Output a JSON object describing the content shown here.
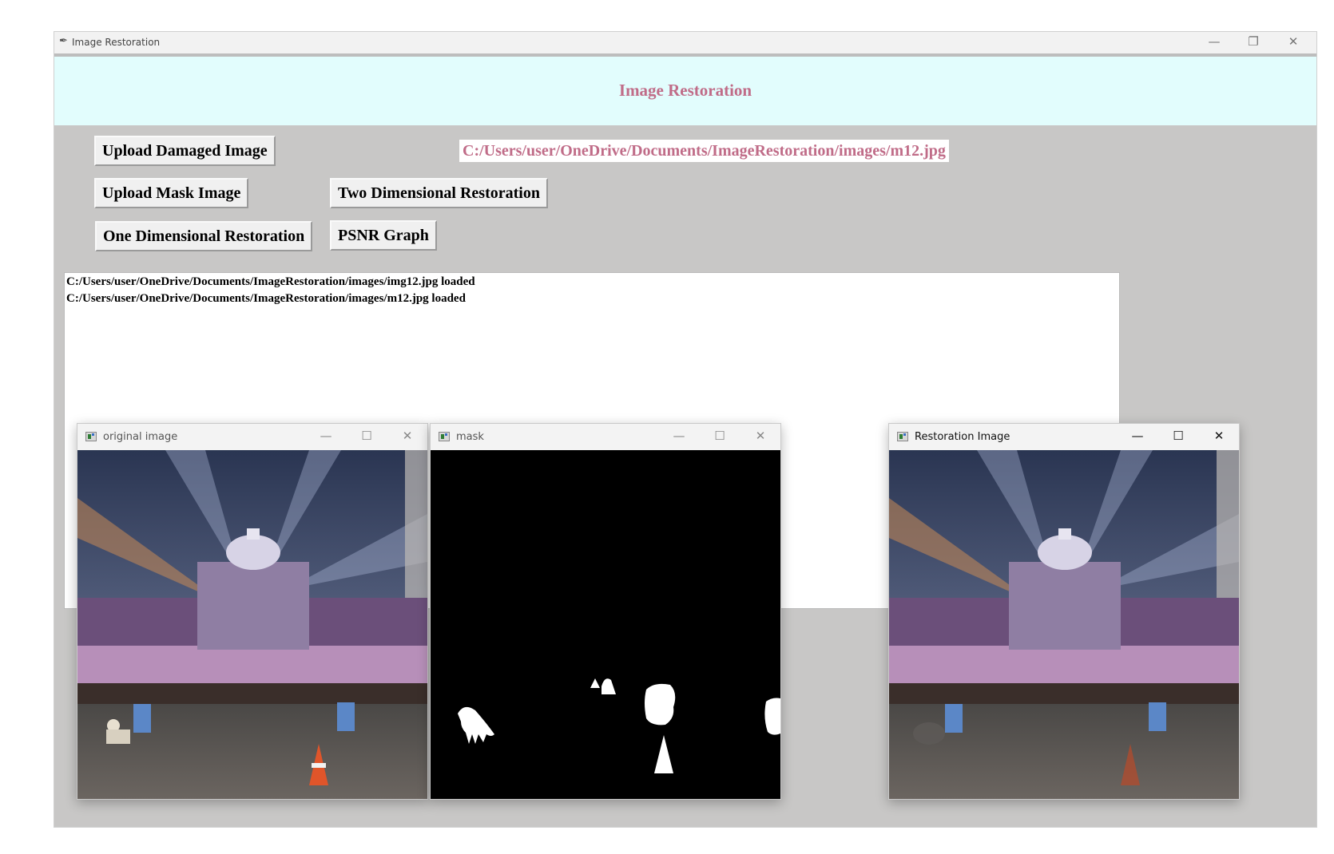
{
  "window": {
    "title": "Image Restoration",
    "controls": {
      "minimize": "—",
      "maximize": "❐",
      "close": "✕"
    }
  },
  "header": {
    "title": "Image Restoration"
  },
  "buttons": {
    "upload_damaged": "Upload Damaged Image",
    "upload_mask": "Upload Mask Image",
    "two_dimensional": "Two Dimensional Restoration",
    "one_dimensional": "One Dimensional Restoration",
    "psnr_graph": "PSNR Graph"
  },
  "path_label": "C:/Users/user/OneDrive/Documents/ImageRestoration/images/m12.jpg",
  "console": {
    "lines": [
      "C:/Users/user/OneDrive/Documents/ImageRestoration/images/img12.jpg loaded",
      "C:/Users/user/OneDrive/Documents/ImageRestoration/images/m12.jpg loaded"
    ]
  },
  "cv_windows": [
    {
      "title": "original image"
    },
    {
      "title": "mask"
    },
    {
      "title": "Restoration Image"
    }
  ],
  "cv_controls": {
    "minimize": "—",
    "maximize": "☐",
    "close": "✕"
  },
  "icons": {
    "app": "feather-icon",
    "cv": "opencv-window-icon"
  }
}
